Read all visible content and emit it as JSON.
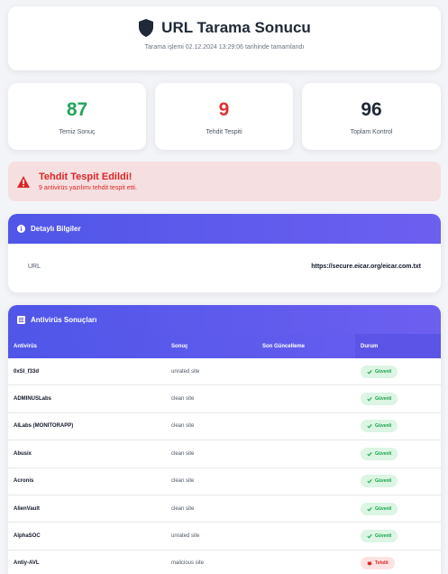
{
  "header": {
    "title": "URL Tarama Sonucu",
    "subtitle": "Tarama işlemi 02.12.2024 13:29:06 tarihinde tamamlandı"
  },
  "stats": [
    {
      "value": "87",
      "label": "Temiz Sonuç",
      "color": "#22a55a"
    },
    {
      "value": "9",
      "label": "Tehdit Tespiti",
      "color": "#e03131"
    },
    {
      "value": "96",
      "label": "Toplam Kontrol",
      "color": "#1f2937"
    }
  ],
  "alert": {
    "title": "Tehdit Tespit Edildi!",
    "description": "9 antivirüs yazılımı tehdit tespit etti."
  },
  "details": {
    "title": "Detaylı Bilgiler",
    "url_label": "URL",
    "url_value": "https://secure.eicar.org/eicar.com.txt"
  },
  "results": {
    "title": "Antivirüs Sonuçları",
    "columns": [
      "Antivirüs",
      "Sonuç",
      "Son Güncelleme",
      "Durum"
    ],
    "rows": [
      {
        "name": "0xSI_f33d",
        "result": "unrated site",
        "updated": "",
        "status": "Güvenli",
        "ok": true
      },
      {
        "name": "ADMINUSLabs",
        "result": "clean site",
        "updated": "",
        "status": "Güvenli",
        "ok": true
      },
      {
        "name": "AILabs (MONITORAPP)",
        "result": "clean site",
        "updated": "",
        "status": "Güvenli",
        "ok": true
      },
      {
        "name": "Abusix",
        "result": "clean site",
        "updated": "",
        "status": "Güvenli",
        "ok": true
      },
      {
        "name": "Acronis",
        "result": "clean site",
        "updated": "",
        "status": "Güvenli",
        "ok": true
      },
      {
        "name": "AlienVault",
        "result": "clean site",
        "updated": "",
        "status": "Güvenli",
        "ok": true
      },
      {
        "name": "AlphaSOC",
        "result": "unrated site",
        "updated": "",
        "status": "Güvenli",
        "ok": true
      },
      {
        "name": "Antiy-AVL",
        "result": "malicious site",
        "updated": "",
        "status": "Tehdit",
        "ok": false
      }
    ]
  },
  "colors": {
    "accent": "#4f56e8",
    "clean": "#22a55a",
    "threat": "#e03131"
  }
}
